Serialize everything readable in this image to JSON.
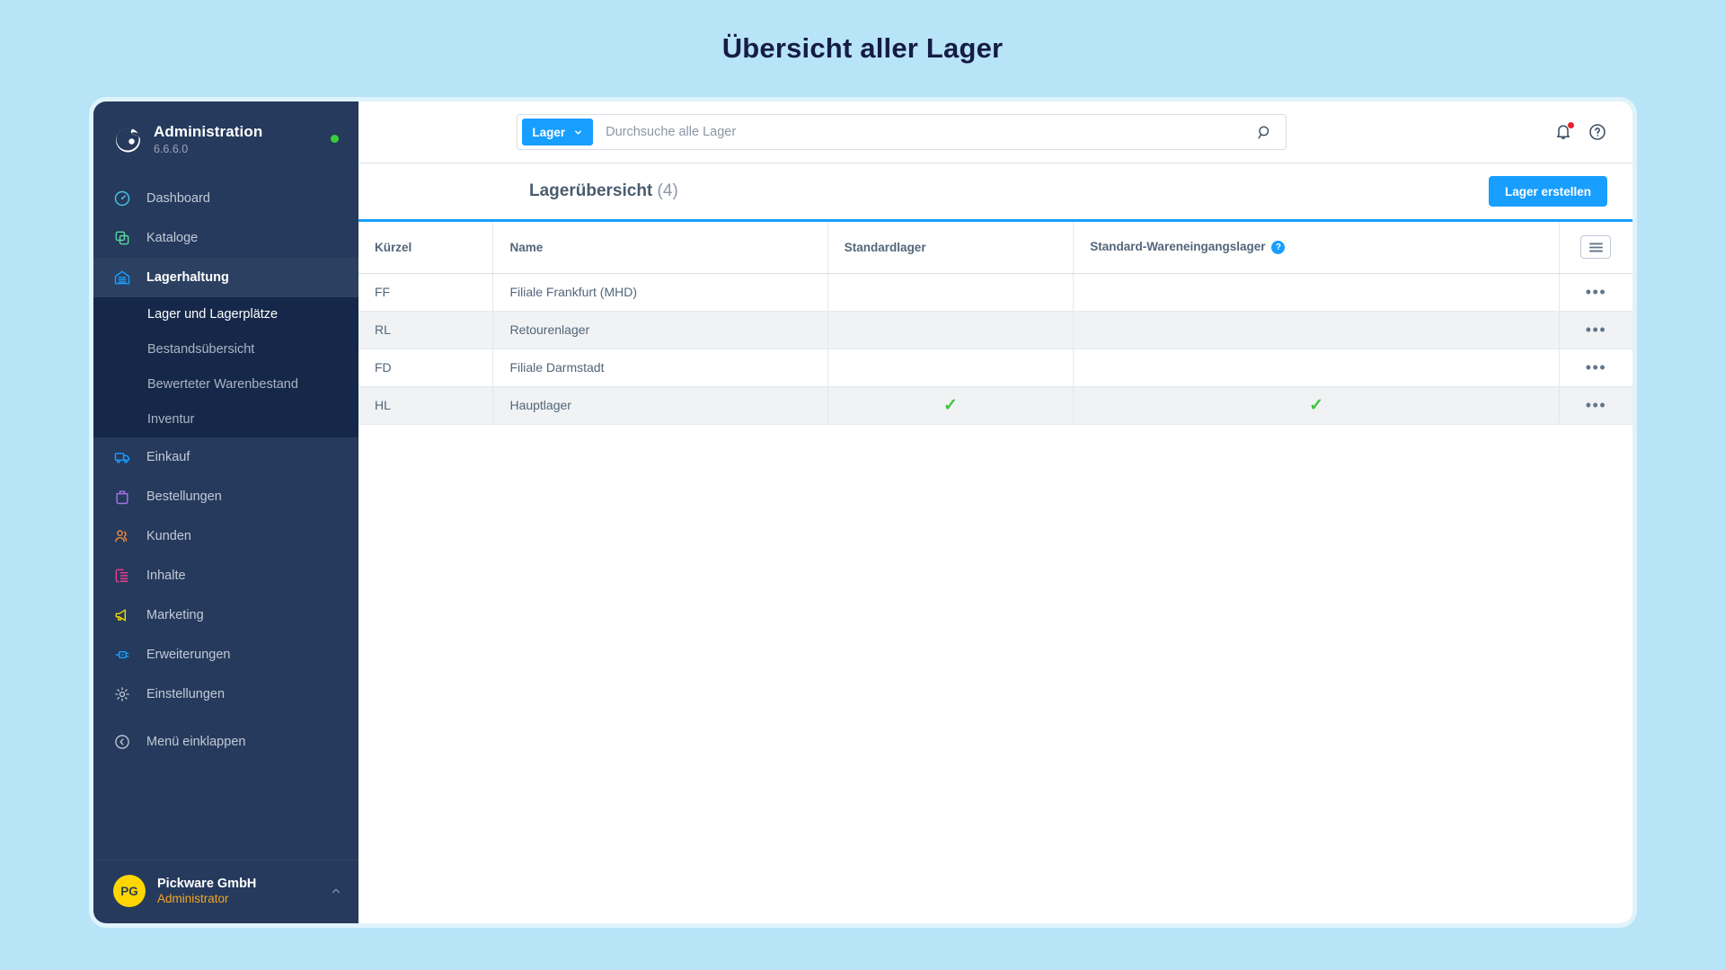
{
  "page": {
    "title": "Übersicht aller Lager"
  },
  "sidebar": {
    "brand": {
      "name": "Administration",
      "version": "6.6.6.0",
      "status_color": "#37d039"
    },
    "items": [
      {
        "label": "Dashboard",
        "icon": "dashboard-speedometer-icon",
        "color": "#4bc4e8",
        "active": false
      },
      {
        "label": "Kataloge",
        "icon": "catalog-copy-icon",
        "color": "#5ad6a0",
        "active": false
      },
      {
        "label": "Lagerhaltung",
        "icon": "warehouse-icon",
        "color": "#189eff",
        "active": true
      }
    ],
    "sub_items": [
      {
        "label": "Lager und Lagerplätze",
        "active": true
      },
      {
        "label": "Bestandsübersicht",
        "active": false
      },
      {
        "label": "Bewerteter Warenbestand",
        "active": false
      },
      {
        "label": "Inventur",
        "active": false
      }
    ],
    "items_lower": [
      {
        "label": "Einkauf",
        "icon": "truck-icon",
        "color": "#189eff"
      },
      {
        "label": "Bestellungen",
        "icon": "bag-icon",
        "color": "#a772e8"
      },
      {
        "label": "Kunden",
        "icon": "users-icon",
        "color": "#f08a3c"
      },
      {
        "label": "Inhalte",
        "icon": "content-list-icon",
        "color": "#ef3c8c"
      },
      {
        "label": "Marketing",
        "icon": "megaphone-icon",
        "color": "#f5d800"
      },
      {
        "label": "Erweiterungen",
        "icon": "plugin-icon",
        "color": "#189eff"
      },
      {
        "label": "Einstellungen",
        "icon": "gear-icon",
        "color": "#c2cad6"
      }
    ],
    "collapse": {
      "label": "Menü einklappen",
      "icon": "chevron-left-circle-icon",
      "color": "#c2cad6"
    },
    "user": {
      "initials": "PG",
      "name": "Pickware GmbH",
      "role": "Administrator",
      "avatar_color": "#ffd600",
      "role_color": "#f5a623"
    }
  },
  "topbar": {
    "search": {
      "scope_label": "Lager",
      "placeholder": "Durchsuche alle Lager",
      "value": ""
    },
    "notifications_icon": "bell-icon",
    "help_icon": "question-circle-icon",
    "has_notification": true
  },
  "toolbar": {
    "title": "Lagerübersicht",
    "count": "(4)",
    "create_label": "Lager erstellen",
    "accent_color": "#189eff"
  },
  "table": {
    "columns": [
      {
        "key": "kurzel",
        "label": "Kürzel"
      },
      {
        "key": "name",
        "label": "Name"
      },
      {
        "key": "standardlager",
        "label": "Standardlager"
      },
      {
        "key": "wareneingangslager",
        "label": "Standard-Wareneingangslager",
        "help": "?"
      }
    ],
    "settings_icon": "hamburger-menu-icon",
    "row_menu_label": "•••",
    "rows": [
      {
        "kurzel": "FF",
        "name": "Filiale Frankfurt (MHD)",
        "standardlager": "",
        "wareneingangslager": ""
      },
      {
        "kurzel": "RL",
        "name": "Retourenlager",
        "standardlager": "",
        "wareneingangslager": ""
      },
      {
        "kurzel": "FD",
        "name": "Filiale Darmstadt",
        "standardlager": "",
        "wareneingangslager": ""
      },
      {
        "kurzel": "HL",
        "name": "Hauptlager",
        "standardlager": "✓",
        "wareneingangslager": "✓"
      }
    ]
  }
}
